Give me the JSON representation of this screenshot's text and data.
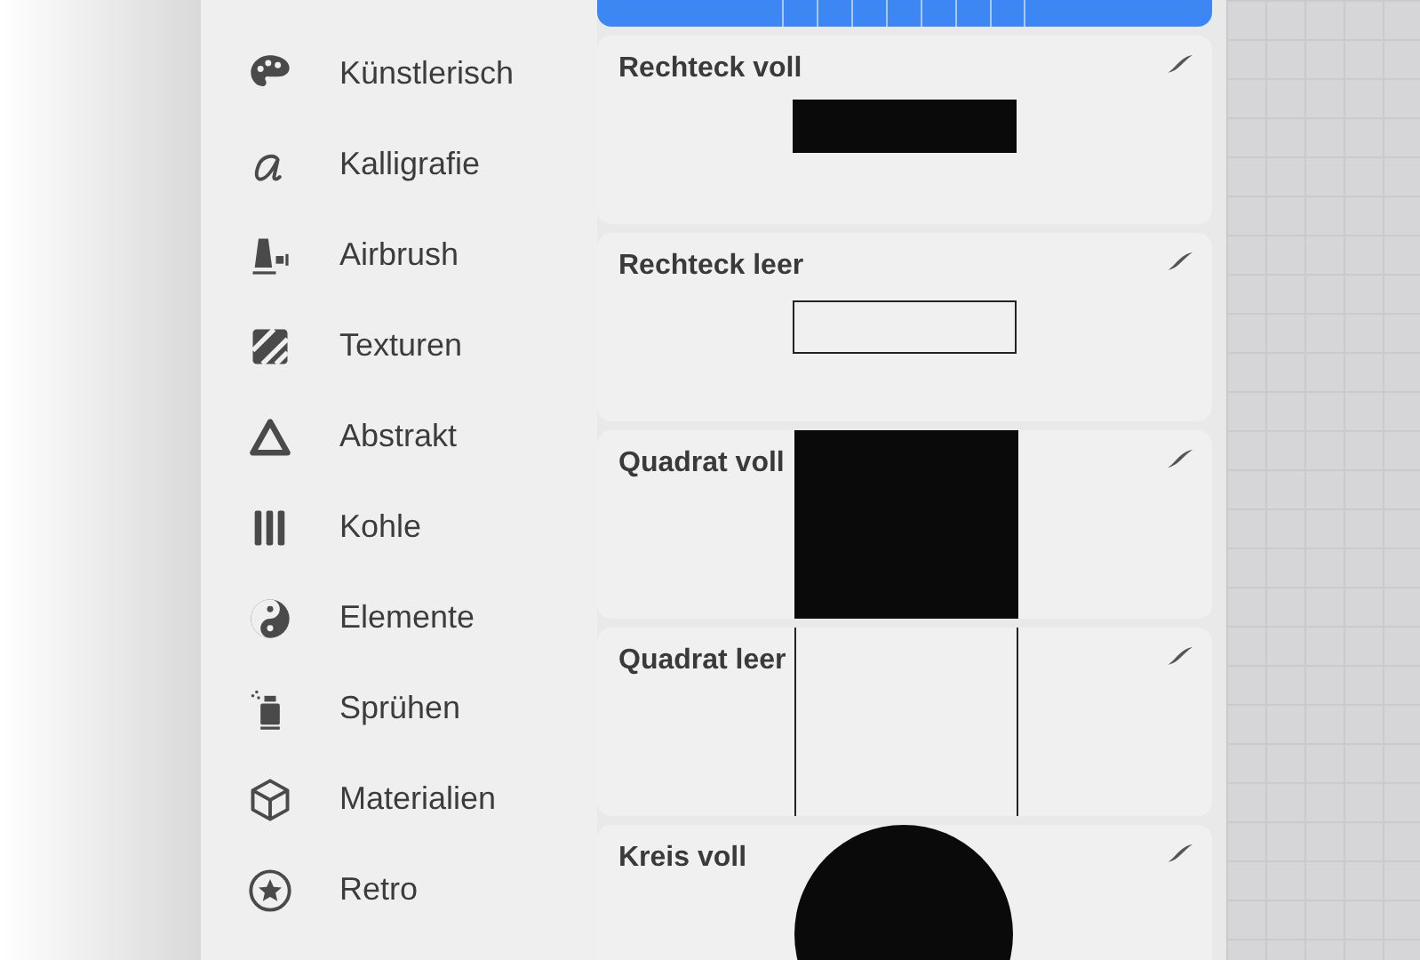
{
  "categories": [
    {
      "kind": "palette",
      "label": "Künstlerisch"
    },
    {
      "kind": "script",
      "label": "Kalligrafie"
    },
    {
      "kind": "airbrush",
      "label": "Airbrush"
    },
    {
      "kind": "stripes",
      "label": "Texturen"
    },
    {
      "kind": "triangle",
      "label": "Abstrakt"
    },
    {
      "kind": "bars",
      "label": "Kohle"
    },
    {
      "kind": "yinyang",
      "label": "Elemente"
    },
    {
      "kind": "spraycan",
      "label": "Sprühen"
    },
    {
      "kind": "cube",
      "label": "Materialien"
    },
    {
      "kind": "star",
      "label": "Retro"
    }
  ],
  "brushes": [
    {
      "selected": true,
      "kind": "grid"
    },
    {
      "selected": false,
      "name": "Rechteck voll",
      "kind": "rectfilled"
    },
    {
      "selected": false,
      "name": "Rechteck leer",
      "kind": "rectoutline"
    },
    {
      "selected": false,
      "name": "Quadrat voll",
      "kind": "squarefilled"
    },
    {
      "selected": false,
      "name": "Quadrat leer",
      "kind": "squareoutline"
    },
    {
      "selected": false,
      "name": "Kreis voll",
      "kind": "circlefilled"
    }
  ]
}
